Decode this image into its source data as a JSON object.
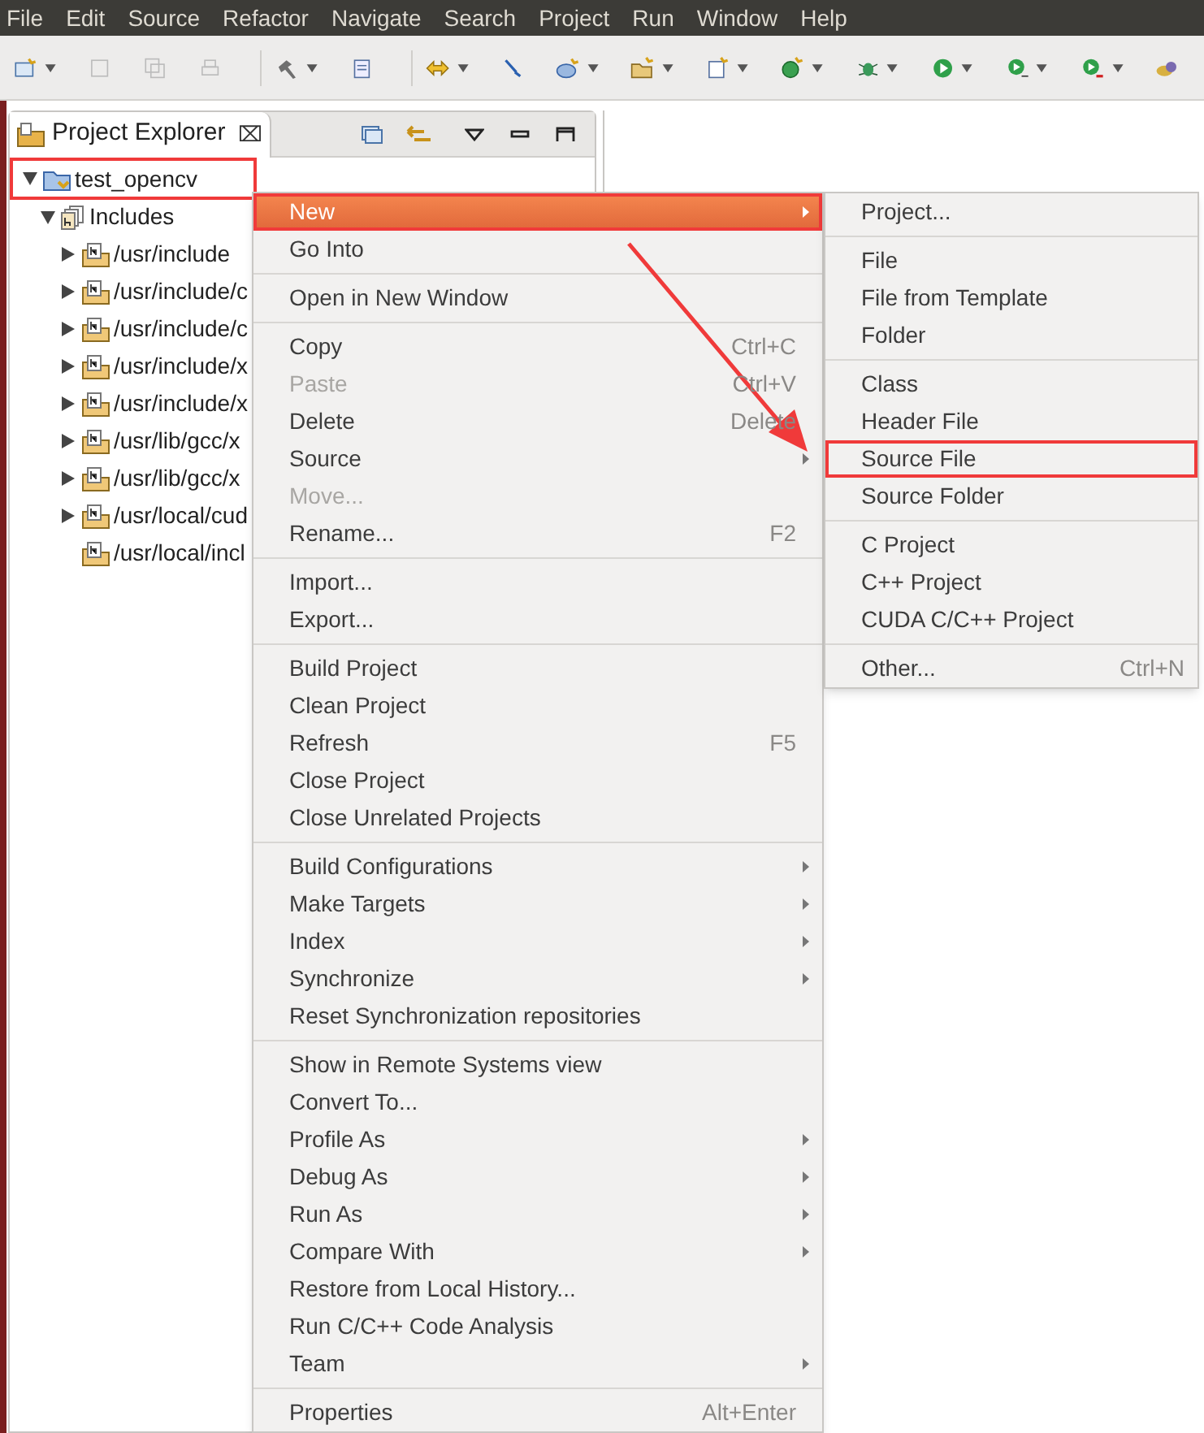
{
  "menu_bar": [
    "File",
    "Edit",
    "Source",
    "Refactor",
    "Navigate",
    "Search",
    "Project",
    "Run",
    "Window",
    "Help"
  ],
  "project_explorer": {
    "title": "Project Explorer",
    "close": "⌧",
    "tree": [
      {
        "label": "test_opencv",
        "kind": "project",
        "expanded": true,
        "annotated": true,
        "children": [
          {
            "label": "Includes",
            "kind": "includes",
            "expanded": true,
            "annotated": false,
            "children": [
              {
                "label": "/usr/include",
                "kind": "folder",
                "expanded": false,
                "annotated": false
              },
              {
                "label": "/usr/include/c",
                "kind": "folder",
                "expanded": false,
                "annotated": false
              },
              {
                "label": "/usr/include/c",
                "kind": "folder",
                "expanded": false,
                "annotated": false
              },
              {
                "label": "/usr/include/x",
                "kind": "folder",
                "expanded": false,
                "annotated": false
              },
              {
                "label": "/usr/include/x",
                "kind": "folder",
                "expanded": false,
                "annotated": false
              },
              {
                "label": "/usr/lib/gcc/x",
                "kind": "folder",
                "expanded": false,
                "annotated": false
              },
              {
                "label": "/usr/lib/gcc/x",
                "kind": "folder",
                "expanded": false,
                "annotated": false
              },
              {
                "label": "/usr/local/cud",
                "kind": "folder",
                "expanded": false,
                "annotated": false
              },
              {
                "label": "/usr/local/incl",
                "kind": "folder",
                "annotated": false
              }
            ]
          }
        ]
      }
    ]
  },
  "context_menu": {
    "groups": [
      [
        {
          "label": "New",
          "submenu": true,
          "disabled": false,
          "selected": true,
          "annotated": true
        },
        {
          "label": "Go Into",
          "submenu": false,
          "disabled": false,
          "selected": false,
          "annotated": false
        }
      ],
      [
        {
          "label": "Open in New Window",
          "submenu": false,
          "disabled": false,
          "selected": false,
          "annotated": false
        }
      ],
      [
        {
          "label": "Copy",
          "shortcut": "Ctrl+C",
          "submenu": false,
          "disabled": false,
          "selected": false,
          "annotated": false
        },
        {
          "label": "Paste",
          "shortcut": "Ctrl+V",
          "submenu": false,
          "disabled": true,
          "selected": false,
          "annotated": false
        },
        {
          "label": "Delete",
          "shortcut": "Delete",
          "submenu": false,
          "disabled": false,
          "selected": false,
          "annotated": false
        },
        {
          "label": "Source",
          "submenu": true,
          "disabled": false,
          "selected": false,
          "annotated": false
        },
        {
          "label": "Move...",
          "submenu": false,
          "disabled": true,
          "selected": false,
          "annotated": false
        },
        {
          "label": "Rename...",
          "shortcut": "F2",
          "submenu": false,
          "disabled": false,
          "selected": false,
          "annotated": false
        }
      ],
      [
        {
          "label": "Import...",
          "submenu": false,
          "disabled": false,
          "selected": false,
          "annotated": false
        },
        {
          "label": "Export...",
          "submenu": false,
          "disabled": false,
          "selected": false,
          "annotated": false
        }
      ],
      [
        {
          "label": "Build Project",
          "submenu": false,
          "disabled": false,
          "selected": false,
          "annotated": false
        },
        {
          "label": "Clean Project",
          "submenu": false,
          "disabled": false,
          "selected": false,
          "annotated": false
        },
        {
          "label": "Refresh",
          "shortcut": "F5",
          "submenu": false,
          "disabled": false,
          "selected": false,
          "annotated": false
        },
        {
          "label": "Close Project",
          "submenu": false,
          "disabled": false,
          "selected": false,
          "annotated": false
        },
        {
          "label": "Close Unrelated Projects",
          "submenu": false,
          "disabled": false,
          "selected": false,
          "annotated": false
        }
      ],
      [
        {
          "label": "Build Configurations",
          "submenu": true,
          "disabled": false,
          "selected": false,
          "annotated": false
        },
        {
          "label": "Make Targets",
          "submenu": true,
          "disabled": false,
          "selected": false,
          "annotated": false
        },
        {
          "label": "Index",
          "submenu": true,
          "disabled": false,
          "selected": false,
          "annotated": false
        },
        {
          "label": "Synchronize",
          "submenu": true,
          "disabled": false,
          "selected": false,
          "annotated": false
        },
        {
          "label": "Reset Synchronization repositories",
          "submenu": false,
          "disabled": false,
          "selected": false,
          "annotated": false
        }
      ],
      [
        {
          "label": "Show in Remote Systems view",
          "submenu": false,
          "disabled": false,
          "selected": false,
          "annotated": false
        },
        {
          "label": "Convert To...",
          "submenu": false,
          "disabled": false,
          "selected": false,
          "annotated": false
        },
        {
          "label": "Profile As",
          "submenu": true,
          "disabled": false,
          "selected": false,
          "annotated": false
        },
        {
          "label": "Debug As",
          "submenu": true,
          "disabled": false,
          "selected": false,
          "annotated": false
        },
        {
          "label": "Run As",
          "submenu": true,
          "disabled": false,
          "selected": false,
          "annotated": false
        },
        {
          "label": "Compare With",
          "submenu": true,
          "disabled": false,
          "selected": false,
          "annotated": false
        },
        {
          "label": "Restore from Local History...",
          "submenu": false,
          "disabled": false,
          "selected": false,
          "annotated": false
        },
        {
          "label": "Run C/C++ Code Analysis",
          "submenu": false,
          "disabled": false,
          "selected": false,
          "annotated": false
        },
        {
          "label": "Team",
          "submenu": true,
          "disabled": false,
          "selected": false,
          "annotated": false
        }
      ],
      [
        {
          "label": "Properties",
          "shortcut": "Alt+Enter",
          "submenu": false,
          "disabled": false,
          "selected": false,
          "annotated": false
        }
      ]
    ]
  },
  "new_submenu": {
    "groups": [
      [
        {
          "label": "Project...",
          "annotated": false
        }
      ],
      [
        {
          "label": "File",
          "annotated": false
        },
        {
          "label": "File from Template",
          "annotated": false
        },
        {
          "label": "Folder",
          "annotated": false
        }
      ],
      [
        {
          "label": "Class",
          "annotated": false
        },
        {
          "label": "Header File",
          "annotated": false
        },
        {
          "label": "Source File",
          "annotated": true
        },
        {
          "label": "Source Folder",
          "annotated": false
        }
      ],
      [
        {
          "label": "C Project",
          "annotated": false
        },
        {
          "label": "C++ Project",
          "annotated": false
        },
        {
          "label": "CUDA C/C++ Project",
          "annotated": false
        }
      ],
      [
        {
          "label": "Other...",
          "shortcut": "Ctrl+N",
          "annotated": false
        }
      ]
    ]
  }
}
